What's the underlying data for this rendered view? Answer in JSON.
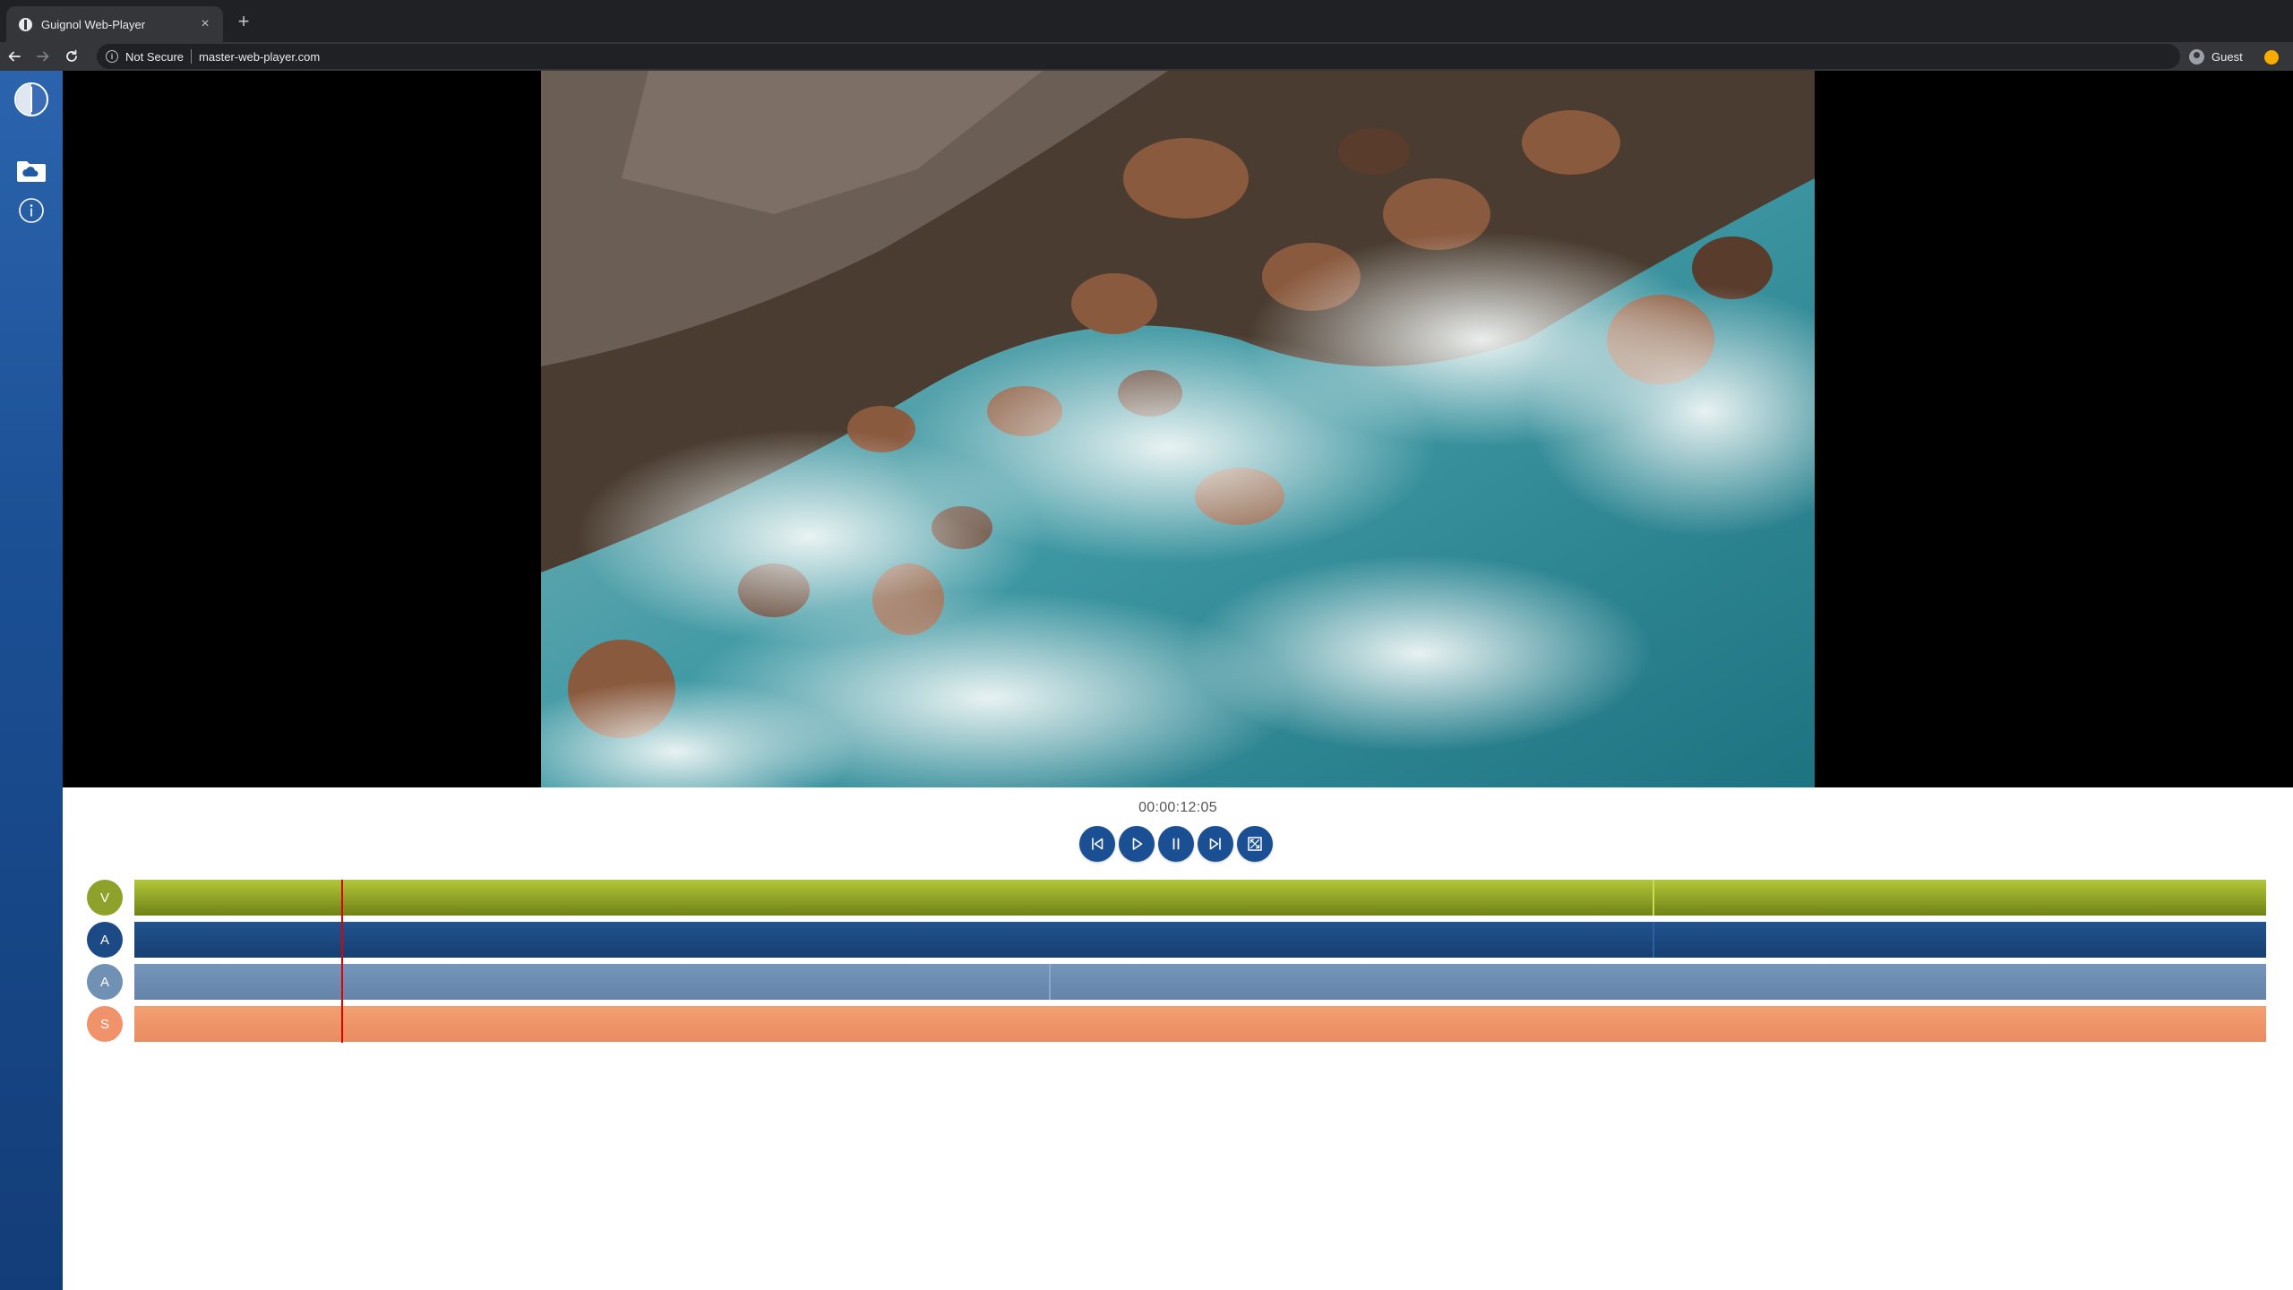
{
  "browser": {
    "tab_title": "Guignol Web-Player",
    "tab_close": "×",
    "new_tab": "+",
    "security_label": "Not Secure",
    "url": "master-web-player.com",
    "profile_label": "Guest",
    "info_glyph": "i"
  },
  "sidebar": {
    "items": [
      {
        "icon": "folder-cloud-icon",
        "label": ""
      },
      {
        "icon": "info-icon",
        "label": ""
      }
    ]
  },
  "player": {
    "timecode": "00:00:12:05",
    "progress_fraction": 0.097,
    "controls": [
      {
        "name": "previous-button",
        "icon": "skip-back-icon"
      },
      {
        "name": "play-button",
        "icon": "play-icon"
      },
      {
        "name": "pause-button",
        "icon": "pause-icon"
      },
      {
        "name": "next-button",
        "icon": "skip-forward-icon"
      },
      {
        "name": "fullscreen-button",
        "icon": "fullscreen-icon"
      }
    ]
  },
  "tracks": [
    {
      "label": "V",
      "kind": "video",
      "badge_color": "#8ea12a",
      "bar_top": "#b3c73a",
      "bar_bottom": "#6f8216",
      "segment_cut": 0.712,
      "cut_color": "#c9db52"
    },
    {
      "label": "A",
      "kind": "audio",
      "badge_color": "#1c4a85",
      "bar_top": "#21538f",
      "bar_bottom": "#173f71",
      "segment_cut": 0.712,
      "cut_color": "#2b5f9f"
    },
    {
      "label": "A",
      "kind": "audio",
      "badge_color": "#7090b4",
      "bar_top": "#7595bb",
      "bar_bottom": "#6683a8",
      "segment_cut": 0.429,
      "cut_color": "#8aa8cb"
    },
    {
      "label": "S",
      "kind": "subtitle",
      "badge_color": "#f0936a",
      "bar_top": "#f39f72",
      "bar_bottom": "#e88c60",
      "segment_cut": null,
      "cut_color": ""
    }
  ],
  "colors": {
    "accent": "#1a4f94",
    "playhead": "#e30000"
  }
}
